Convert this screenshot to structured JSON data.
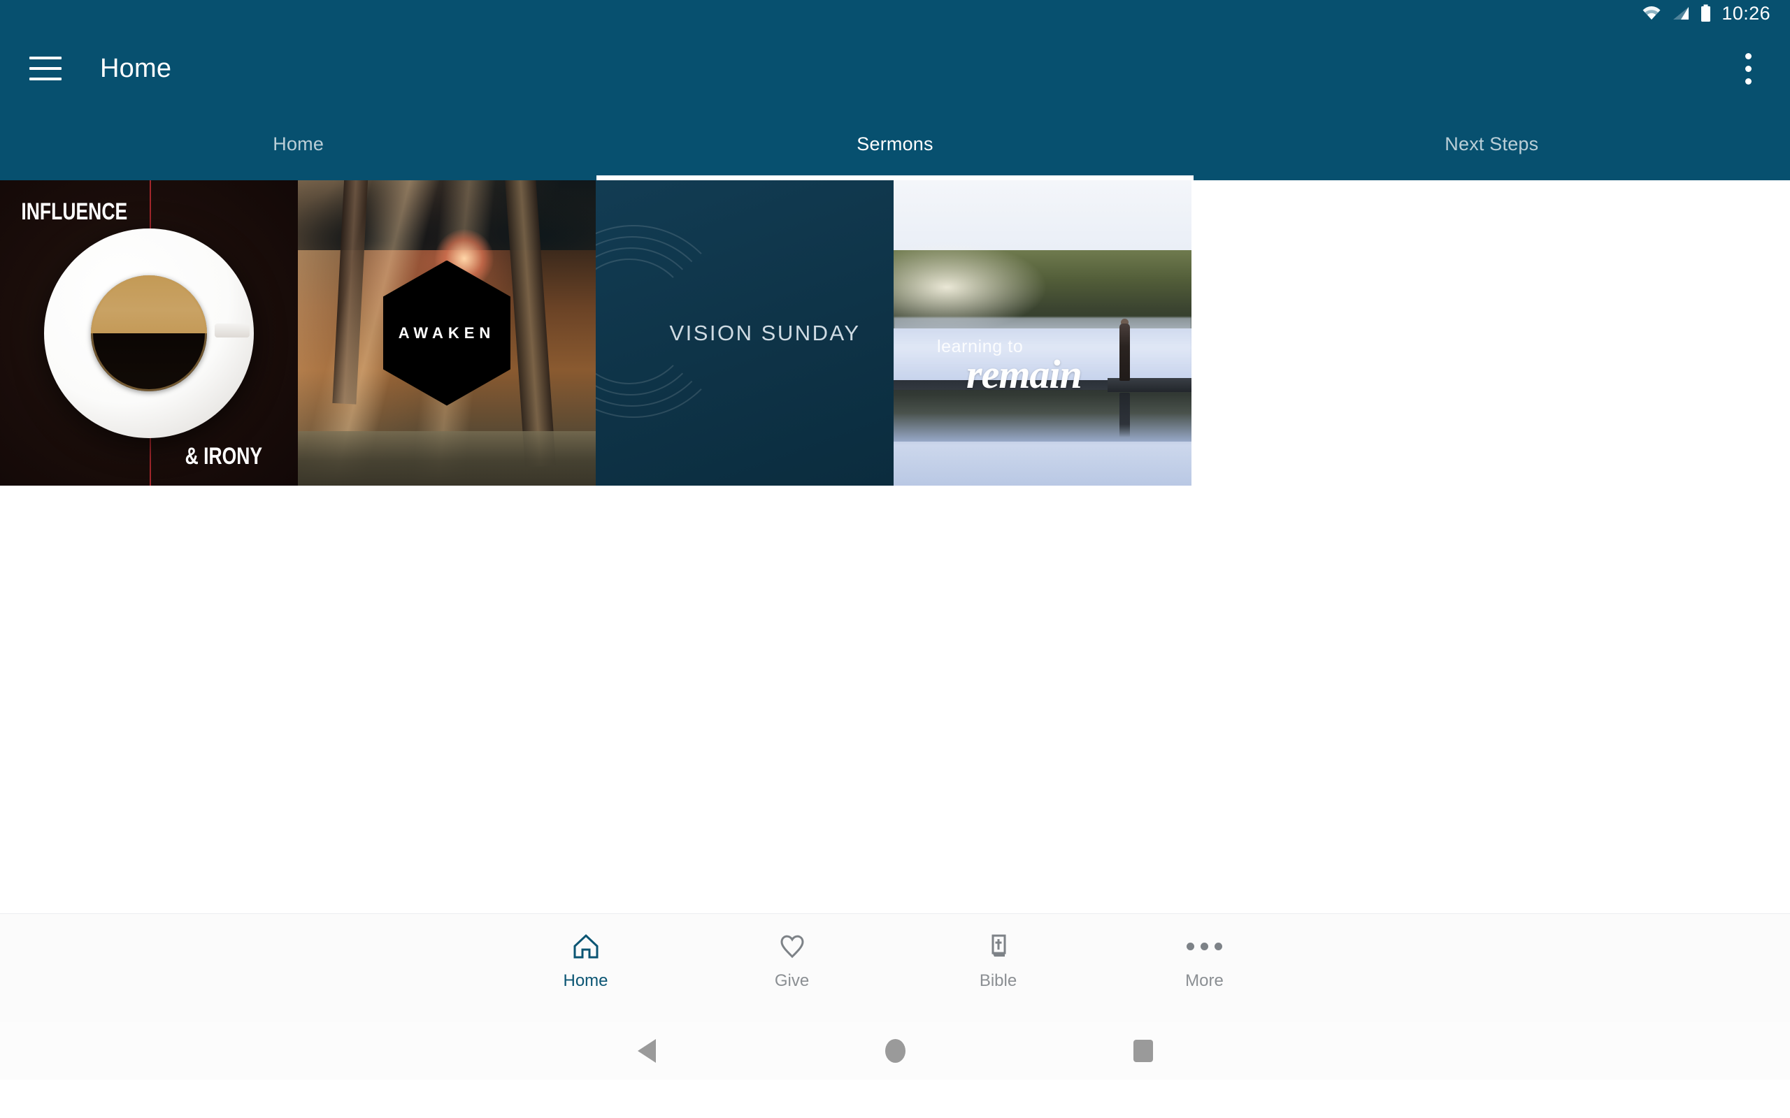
{
  "status_bar": {
    "clock": "10:26",
    "icons": [
      "wifi-icon",
      "cellular-signal-icon",
      "battery-icon"
    ]
  },
  "app_bar": {
    "menu_icon": "hamburger-menu-icon",
    "title": "Home",
    "overflow_icon": "overflow-menu-icon"
  },
  "tabs": {
    "active_index": 1,
    "items": [
      {
        "label": "Home"
      },
      {
        "label": "Sermons"
      },
      {
        "label": "Next Steps"
      }
    ]
  },
  "sermon_cards": [
    {
      "id": "influence-and-irony",
      "title_top": "INFLUENCE",
      "title_bottom": "& IRONY",
      "artwork": "coffee-cup-split-dark",
      "accent_color": "#a3262b",
      "background_color": "#1d0f0c"
    },
    {
      "id": "awaken",
      "title": "AWAKEN",
      "artwork": "sunlit-forest-hexagon",
      "badge_shape": "hexagon",
      "background_color": "#3b2a1e"
    },
    {
      "id": "vision-sunday",
      "title": "VISION  SUNDAY",
      "artwork": "concentric-arcs-navy",
      "background_color": "#0e3348"
    },
    {
      "id": "learning-to-remain",
      "title_line1": "learning to",
      "title_line2": "remain",
      "artwork": "misty-lake-dock-reflection",
      "background_color": "#c3cfe6"
    }
  ],
  "bottom_nav": {
    "active_index": 0,
    "active_color": "#0b5573",
    "inactive_color": "#8b8f93",
    "items": [
      {
        "label": "Home",
        "icon": "home-icon"
      },
      {
        "label": "Give",
        "icon": "heart-icon"
      },
      {
        "label": "Bible",
        "icon": "bible-book-icon"
      },
      {
        "label": "More",
        "icon": "more-dots-icon"
      }
    ]
  },
  "system_nav": {
    "back": "back-triangle-icon",
    "home": "home-circle-icon",
    "recents": "recents-square-icon"
  },
  "theme": {
    "brand_color": "#07506f",
    "page_background": "#ffffff"
  }
}
